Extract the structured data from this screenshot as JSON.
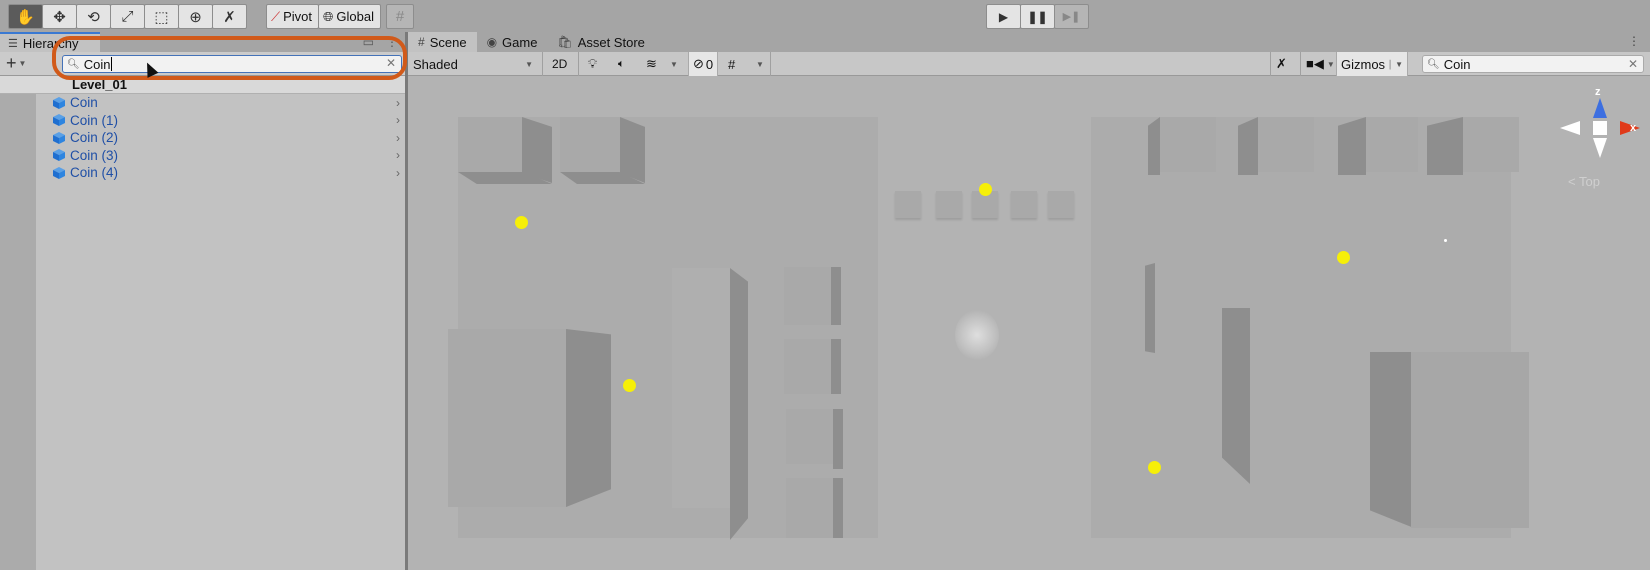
{
  "toolbar": {
    "tools": [
      {
        "name": "hand-tool",
        "icon": "hand-icon",
        "active": true
      },
      {
        "name": "move-tool",
        "icon": "move-icon",
        "active": false
      },
      {
        "name": "rotate-tool",
        "icon": "rotate-icon",
        "active": false
      },
      {
        "name": "scale-tool",
        "icon": "scale-icon",
        "active": false
      },
      {
        "name": "rect-tool",
        "icon": "rect-icon",
        "active": false
      },
      {
        "name": "transform-tool",
        "icon": "transform-icon",
        "active": false
      },
      {
        "name": "custom-tool",
        "icon": "wrench-icon",
        "active": false
      }
    ],
    "pivot_label": "Pivot",
    "global_label": "Global",
    "play_controls": [
      "play",
      "pause",
      "step"
    ]
  },
  "hierarchy": {
    "tab_label": "Hierarchy",
    "search": {
      "value": "Coin",
      "placeholder": ""
    },
    "scene_name": "Level_01",
    "items": [
      {
        "label": "Coin"
      },
      {
        "label": "Coin (1)"
      },
      {
        "label": "Coin (2)"
      },
      {
        "label": "Coin (3)"
      },
      {
        "label": "Coin (4)"
      }
    ]
  },
  "scene": {
    "tabs": [
      {
        "label": "Scene",
        "icon": "grid-icon",
        "active": true
      },
      {
        "label": "Game",
        "icon": "gamepad-icon",
        "active": false
      },
      {
        "label": "Asset Store",
        "icon": "bag-icon",
        "active": false
      }
    ],
    "toolbar": {
      "draw_mode": "Shaded",
      "mode_2d": "2D",
      "hidden_count": "0",
      "gizmos_label": "Gizmos",
      "search_value": "Coin"
    },
    "gizmo": {
      "z_label": "z",
      "x_label": "x",
      "view_label": "Top"
    }
  },
  "colors": {
    "accent_blue": "#3a79d2",
    "highlight_ring": "#d15a1a",
    "coin_yellow": "#f6ef08",
    "item_text": "#1f4fa6"
  }
}
